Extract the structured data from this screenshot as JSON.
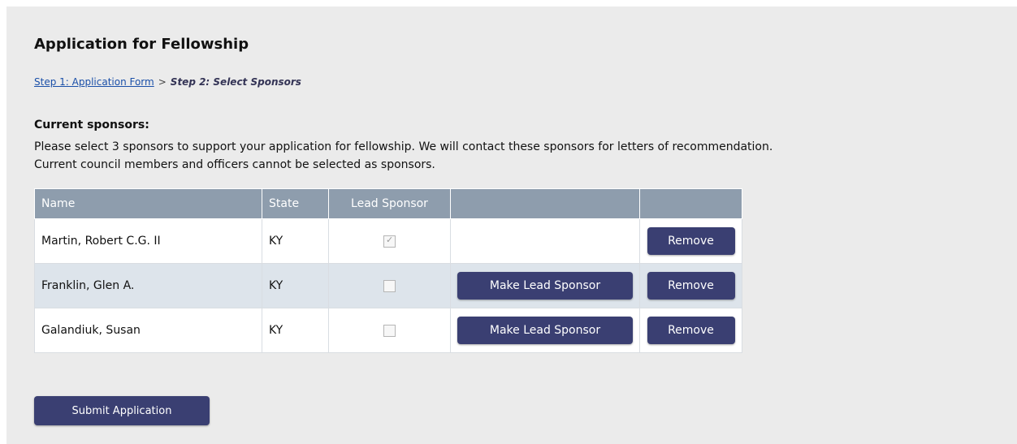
{
  "page": {
    "title": "Application for Fellowship"
  },
  "breadcrumb": {
    "step1_label": "Step 1: Application Form",
    "separator": ">",
    "step2_label": "Step 2: Select Sponsors"
  },
  "sponsors_section": {
    "heading": "Current sponsors:",
    "instructions_line1": "Please select 3 sponsors to support your application for fellowship. We will contact these sponsors for letters of recommendation.",
    "instructions_line2": "Current council members and officers cannot be selected as sponsors."
  },
  "table": {
    "headers": {
      "name": "Name",
      "state": "State",
      "lead_sponsor": "Lead Sponsor",
      "make_lead": "",
      "remove": ""
    },
    "rows": [
      {
        "name": "Martin, Robert C.G. II",
        "state": "KY",
        "lead_sponsor": true,
        "make_lead_label": "",
        "remove_label": "Remove"
      },
      {
        "name": "Franklin, Glen A.",
        "state": "KY",
        "lead_sponsor": false,
        "make_lead_label": "Make Lead Sponsor",
        "remove_label": "Remove"
      },
      {
        "name": "Galandiuk, Susan",
        "state": "KY",
        "lead_sponsor": false,
        "make_lead_label": "Make Lead Sponsor",
        "remove_label": "Remove"
      }
    ]
  },
  "actions": {
    "submit_label": "Submit Application"
  },
  "colors": {
    "panel_background": "#ebebeb",
    "table_header": "#8e9dad",
    "alt_row": "#dde4eb",
    "button": "#3a3f72",
    "link": "#1a4fa8"
  }
}
